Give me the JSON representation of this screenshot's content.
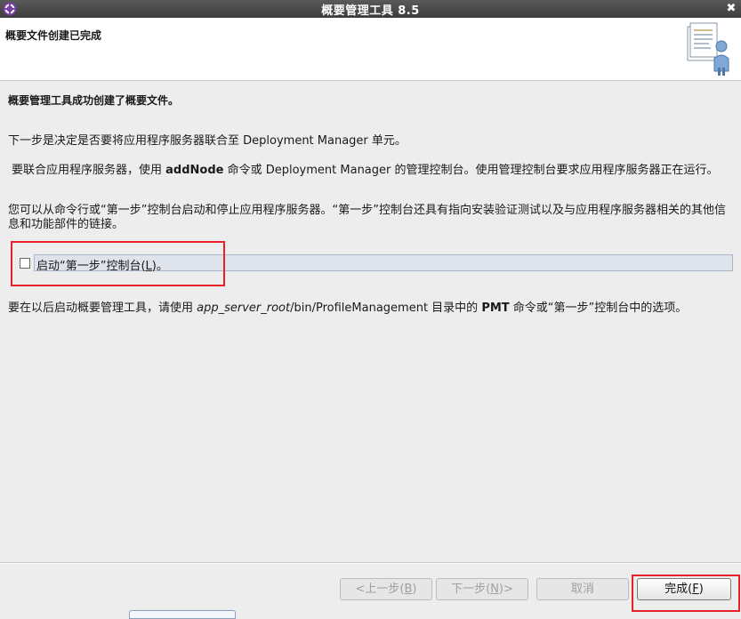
{
  "window": {
    "title": "概要管理工具 8.5",
    "close_symbol": "✖"
  },
  "banner": {
    "title": "概要文件创建已完成"
  },
  "content": {
    "success": "概要管理工具成功创建了概要文件。",
    "next_step": "下一步是决定是否要将应用程序服务器联合至 Deployment Manager 单元。",
    "addnode": {
      "before": "要联合应用程序服务器，使用 ",
      "command": "addNode",
      "after": " 命令或 Deployment Manager 的管理控制台。使用管理控制台要求应用程序服务器正在运行。"
    },
    "firststeps_para_line1": "您可以从命令行或“第一步”控制台启动和停止应用程序服务器。“第一步”控制台还具有指向安装验证测试以及与应用程序服务器相关的其他信",
    "firststeps_para_line2": "息和功能部件的链接。",
    "checkbox": {
      "label_before": "启动“第一步”控制台(",
      "mnemonic": "L",
      "label_after": ")。",
      "checked": false
    },
    "pmt": {
      "before": "要在以后启动概要管理工具，请使用 ",
      "path_italic": "app_server_root",
      "path_rest": "/bin/ProfileManagement 目录中的 ",
      "command": "PMT",
      "after": " 命令或“第一步”控制台中的选项。"
    }
  },
  "buttons": {
    "back": {
      "before": "<上一步(",
      "mnemonic": "B",
      "after": ")",
      "enabled": false
    },
    "next": {
      "before": "下一步(",
      "mnemonic": "N",
      "after": ")>",
      "enabled": false
    },
    "cancel": {
      "label": "取消",
      "enabled": false
    },
    "finish": {
      "before": "完成(",
      "mnemonic": "F",
      "after": ")",
      "enabled": true
    }
  },
  "colors": {
    "titlebar": "#3c3c3c",
    "highlight": "#e8202a",
    "checkbox_row": "#dfe4ec"
  }
}
